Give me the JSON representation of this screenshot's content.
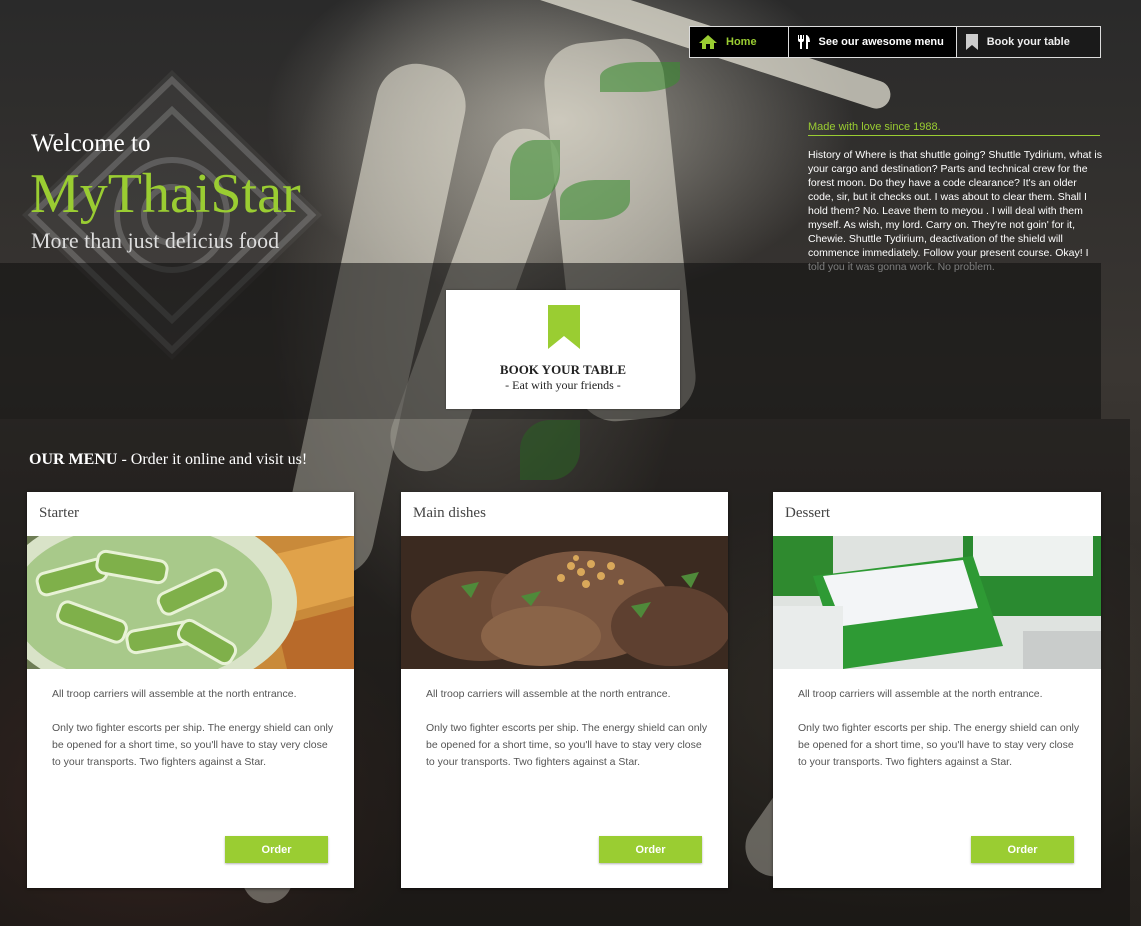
{
  "nav": {
    "home": "Home",
    "menu": "See our awesome menu",
    "book": "Book your table"
  },
  "hero": {
    "welcome": "Welcome to",
    "brand": "MyThaiStar",
    "tagline": "More than just delicius food",
    "since": "Made with love since 1988.",
    "history": "History of Where is that shuttle going? Shuttle Tydirium, what is your cargo and destination? Parts and technical crew for the forest moon. Do they have a code clearance? It's an older code, sir, but it checks out. I was about to clear them. Shall I hold them? No. Leave them to meyou . I will deal with them myself. As wish, my lord. Carry on. They're not goin' for it, Chewie. Shuttle Tydirium, deactivation of the shield will commence immediately. Follow your present course. Okay! I told you it was gonna work. No problem."
  },
  "booking": {
    "title": "BOOK YOUR TABLE",
    "subtitle": "- Eat with your friends -"
  },
  "menu": {
    "heading_bold": "OUR MENU",
    "heading_rest": " - Order it online and visit us!",
    "cards": [
      {
        "title": "Starter",
        "p1": "All troop carriers will assemble at the north entrance.",
        "p2": "Only two fighter escorts per ship. The energy shield can only be opened for a short time, so you'll have to stay very close to your transports. Two fighters against a Star.",
        "button": "Order"
      },
      {
        "title": "Main dishes",
        "p1": "All troop carriers will assemble at the north entrance.",
        "p2": "Only two fighter escorts per ship. The energy shield can only be opened for a short time, so you'll have to stay very close to your transports. Two fighters against a Star.",
        "button": "Order"
      },
      {
        "title": "Dessert",
        "p1": "All troop carriers will assemble at the north entrance.",
        "p2": "Only two fighter escorts per ship. The energy shield can only be opened for a short time, so you'll have to stay very close to your transports. Two fighters against a Star.",
        "button": "Order"
      }
    ]
  },
  "colors": {
    "accent": "#9acd32",
    "nav_bg": "#000000"
  }
}
